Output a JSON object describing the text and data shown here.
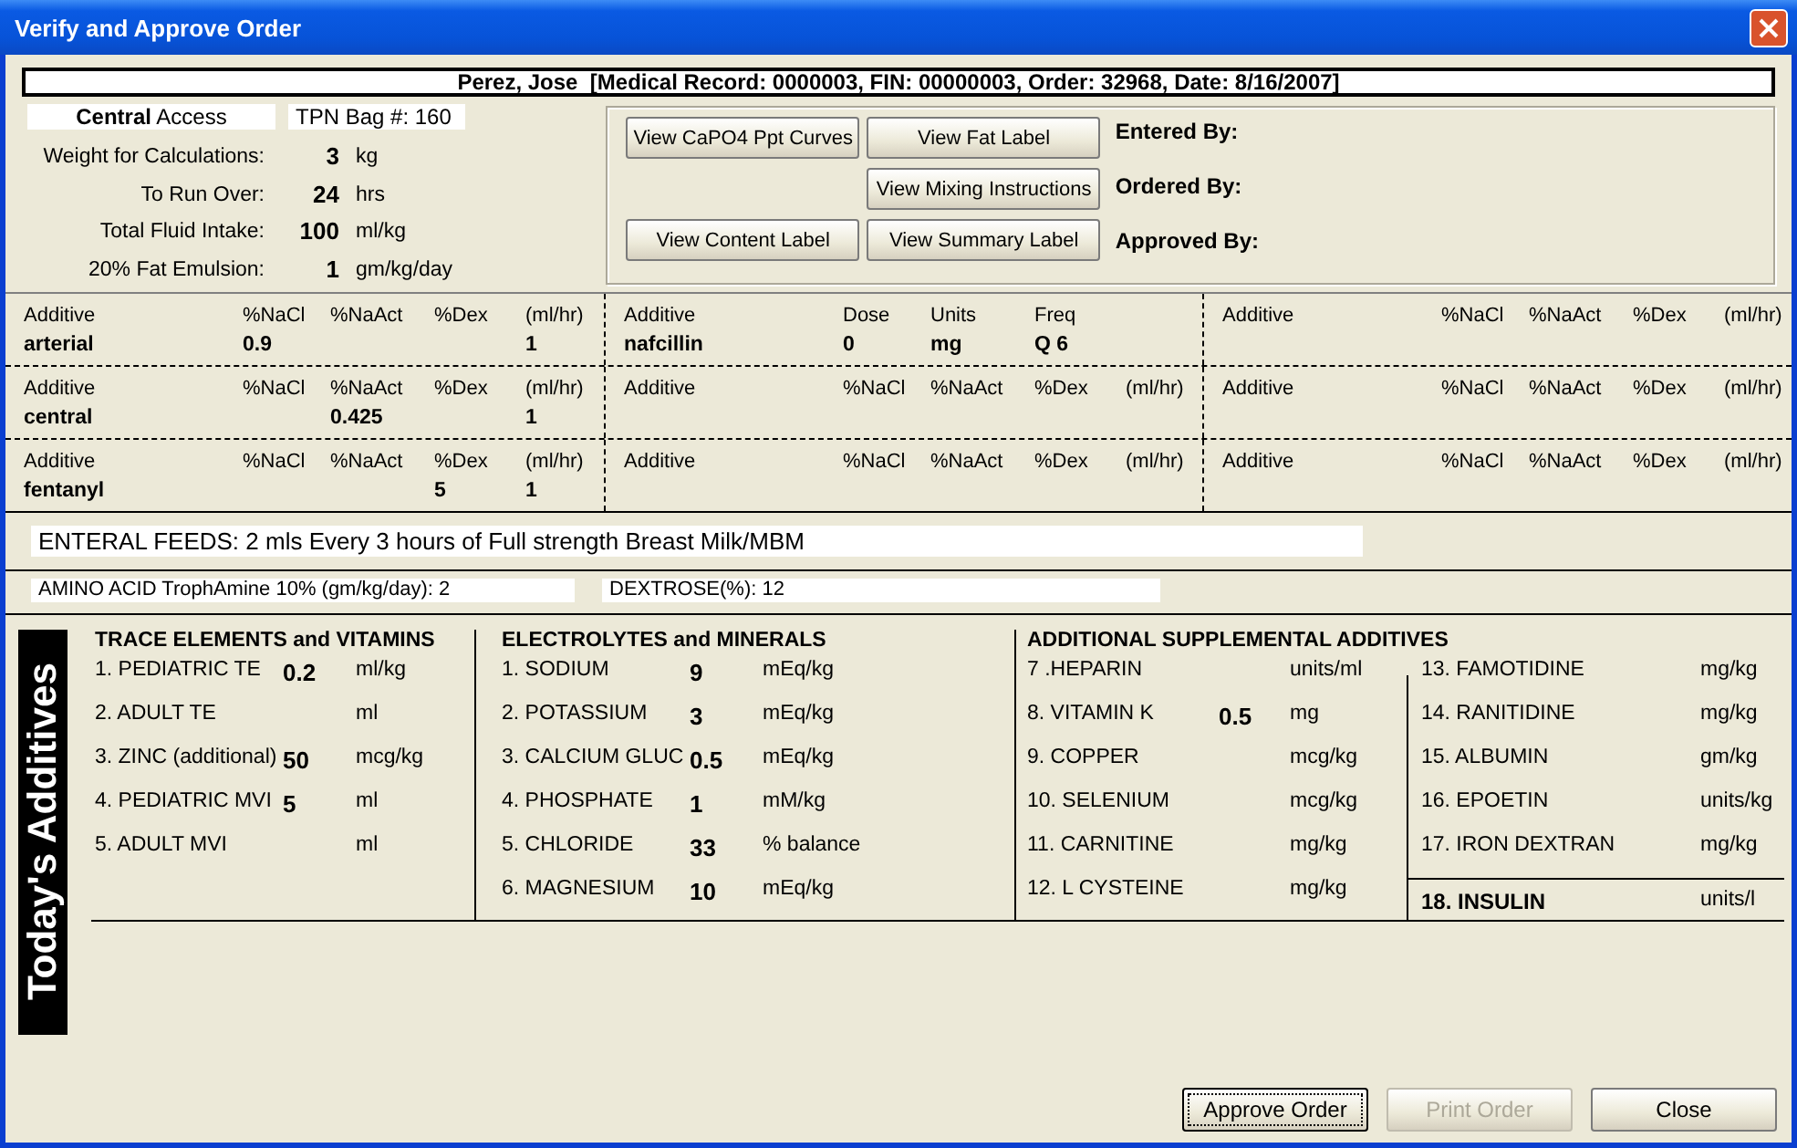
{
  "window": {
    "title": "Verify and Approve Order"
  },
  "patient": "Perez, Jose  [Medical Record: 0000003, FIN: 00000003, Order: 32968, Date: 8/16/2007]",
  "access": "**Central** Access",
  "bag": "TPN Bag #: 160",
  "parameters": [
    {
      "label": "Weight for Calculations:",
      "value": "3",
      "unit": "kg"
    },
    {
      "label": "To Run Over:",
      "value": "24",
      "unit": "hrs"
    },
    {
      "label": "Total Fluid Intake:",
      "value": "100",
      "unit": "ml/kg"
    },
    {
      "label": "20% Fat Emulsion:",
      "value": "1",
      "unit": "gm/kg/day"
    }
  ],
  "label_buttons": [
    [
      "View CaPO4 Ppt Curves",
      "View Fat Label"
    ],
    [
      "View Mixing Instructions"
    ],
    [
      "View Content Label",
      "View Summary Label"
    ]
  ],
  "signoffs": [
    "Entered By:",
    "Ordered By:",
    "Approved By:"
  ],
  "infusions": [
    [
      {
        "cells": [
          {
            "header": "Additive",
            "value": "arterial"
          },
          {
            "header": "%NaCl",
            "value": "0.9"
          },
          {
            "header": "%NaAct"
          },
          {
            "header": "%Dex"
          },
          {
            "header": "(ml/hr)",
            "value": "1"
          }
        ]
      },
      {
        "cells": [
          {
            "header": "Additive",
            "value": "nafcillin"
          },
          {
            "header": "Dose",
            "value": "0"
          },
          {
            "header": "Units",
            "value": "mg"
          },
          {
            "header": "Freq",
            "value": "Q 6"
          },
          {}
        ]
      },
      {
        "cells": [
          {
            "header": "Additive"
          },
          {
            "header": "%NaCl"
          },
          {
            "header": "%NaAct"
          },
          {
            "header": "%Dex"
          },
          {
            "header": "(ml/hr)"
          }
        ]
      }
    ],
    [
      {
        "cells": [
          {
            "header": "Additive",
            "value": "central"
          },
          {
            "header": "%NaCl"
          },
          {
            "header": "%NaAct",
            "value": "0.425"
          },
          {
            "header": "%Dex"
          },
          {
            "header": "(ml/hr)",
            "value": "1"
          }
        ]
      },
      {
        "cells": [
          {
            "header": "Additive"
          },
          {
            "header": "%NaCl"
          },
          {
            "header": "%NaAct"
          },
          {
            "header": "%Dex"
          },
          {
            "header": "(ml/hr)"
          }
        ]
      },
      {
        "cells": [
          {
            "header": "Additive"
          },
          {
            "header": "%NaCl"
          },
          {
            "header": "%NaAct"
          },
          {
            "header": "%Dex"
          },
          {
            "header": "(ml/hr)"
          }
        ]
      }
    ],
    [
      {
        "cells": [
          {
            "header": "Additive",
            "value": "fentanyl"
          },
          {
            "header": "%NaCl"
          },
          {
            "header": "%NaAct"
          },
          {
            "header": "%Dex",
            "value": "5"
          },
          {
            "header": "(ml/hr)",
            "value": "1"
          }
        ]
      },
      {
        "cells": [
          {
            "header": "Additive"
          },
          {
            "header": "%NaCl"
          },
          {
            "header": "%NaAct"
          },
          {
            "header": "%Dex"
          },
          {
            "header": "(ml/hr)"
          }
        ]
      },
      {
        "cells": [
          {
            "header": "Additive"
          },
          {
            "header": "%NaCl"
          },
          {
            "header": "%NaAct"
          },
          {
            "header": "%Dex"
          },
          {
            "header": "(ml/hr)"
          }
        ]
      }
    ]
  ],
  "enteral_feeds": "ENTERAL FEEDS: 2 mls Every 3 hours of Full strength Breast Milk/MBM",
  "amino_acid": "AMINO ACID TrophAmine 10% (gm/kg/day): 2",
  "dextrose": "DEXTROSE(%): 12",
  "additives_title": "Today's Additives",
  "sections": [
    {
      "title": "TRACE ELEMENTS and VITAMINS",
      "columns": [
        [
          {
            "name": "1. PEDIATRIC TE",
            "value": "0.2",
            "unit": "ml/kg"
          },
          {
            "name": "2. ADULT TE",
            "unit": "ml"
          },
          {
            "name": "3. ZINC (additional)",
            "value": "50",
            "unit": "mcg/kg"
          },
          {
            "name": "4. PEDIATRIC MVI",
            "value": "5",
            "unit": "ml"
          },
          {
            "name": "5. ADULT MVI",
            "unit": "ml"
          }
        ]
      ]
    },
    {
      "title": "ELECTROLYTES and MINERALS",
      "columns": [
        [
          {
            "name": "1. SODIUM",
            "value": "9",
            "unit": "mEq/kg"
          },
          {
            "name": "2. POTASSIUM",
            "value": "3",
            "unit": "mEq/kg"
          },
          {
            "name": "3. CALCIUM GLUC",
            "value": "0.5",
            "unit": "mEq/kg"
          },
          {
            "name": "4. PHOSPHATE",
            "value": "1",
            "unit": "mM/kg"
          },
          {
            "name": "5. CHLORIDE",
            "value": "33",
            "unit": "% balance"
          },
          {
            "name": "6. MAGNESIUM",
            "value": "10",
            "unit": "mEq/kg"
          }
        ]
      ]
    },
    {
      "title": "ADDITIONAL SUPPLEMENTAL ADDITIVES",
      "columns": [
        [
          {
            "name": "7 .HEPARIN",
            "unit": "units/ml"
          },
          {
            "name": "8. VITAMIN K",
            "value": "0.5",
            "unit": "mg"
          },
          {
            "name": "9. COPPER",
            "unit": "mcg/kg"
          },
          {
            "name": "10. SELENIUM",
            "unit": "mcg/kg"
          },
          {
            "name": "11. CARNITINE",
            "unit": "mg/kg"
          },
          {
            "name": "12. L CYSTEINE",
            "unit": "mg/kg"
          }
        ],
        [
          {
            "name": "13. FAMOTIDINE",
            "unit": "mg/kg",
            "emphasized": false
          },
          {
            "name": "14. RANITIDINE",
            "unit": "mg/kg",
            "emphasized": false
          },
          {
            "name": "15. ALBUMIN",
            "unit": "gm/kg",
            "emphasized": false
          },
          {
            "name": "16. EPOETIN",
            "unit": "units/kg",
            "emphasized": false
          },
          {
            "name": "17. IRON DEXTRAN",
            "unit": "mg/kg",
            "emphasized": false
          },
          {
            "name": "18. INSULIN",
            "unit": "units/l",
            "emphasized": true
          }
        ]
      ]
    }
  ],
  "buttons": [
    {
      "label": "Approve Order",
      "focused": true,
      "disabled": false
    },
    {
      "label": "Print Order",
      "focused": false,
      "disabled": true
    },
    {
      "label": "Close",
      "focused": false,
      "disabled": false
    }
  ]
}
